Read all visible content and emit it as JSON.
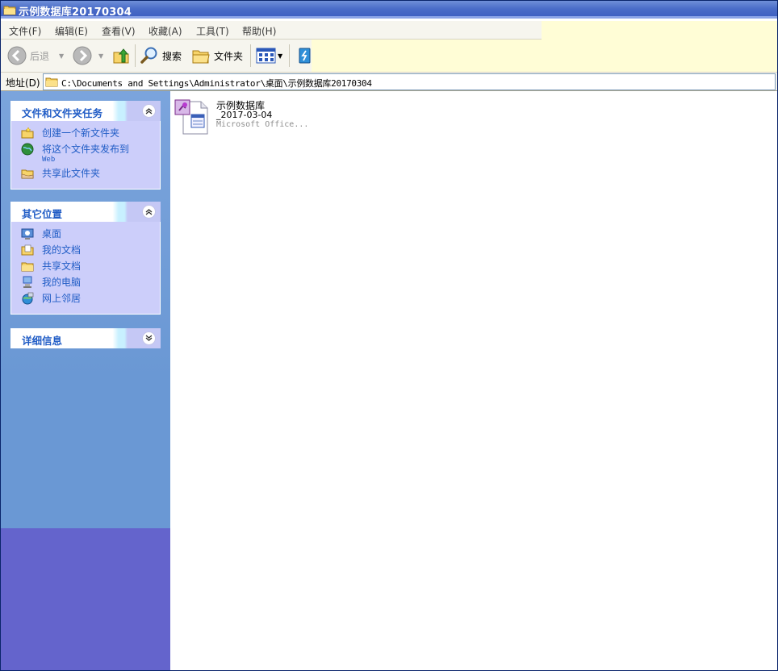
{
  "window": {
    "title": "示例数据库20170304"
  },
  "menu": {
    "items": [
      {
        "label": "文件(F)"
      },
      {
        "label": "编辑(E)"
      },
      {
        "label": "查看(V)"
      },
      {
        "label": "收藏(A)"
      },
      {
        "label": "工具(T)"
      },
      {
        "label": "帮助(H)"
      }
    ]
  },
  "toolbar": {
    "back_label": "后退",
    "search_label": "搜索",
    "folders_label": "文件夹"
  },
  "address": {
    "label": "地址(D)",
    "path": "C:\\Documents and Settings\\Administrator\\桌面\\示例数据库20170304"
  },
  "tasks_panel": {
    "title": "文件和文件夹任务",
    "items": [
      {
        "label": "创建一个新文件夹",
        "icon": "new-folder-icon"
      },
      {
        "label": "将这个文件夹发布到",
        "sub": "Web",
        "icon": "publish-web-icon"
      },
      {
        "label": "共享此文件夹",
        "icon": "share-folder-icon"
      }
    ]
  },
  "places_panel": {
    "title": "其它位置",
    "items": [
      {
        "label": "桌面",
        "icon": "desktop-icon"
      },
      {
        "label": "我的文档",
        "icon": "my-documents-icon"
      },
      {
        "label": "共享文档",
        "icon": "shared-documents-icon"
      },
      {
        "label": "我的电脑",
        "icon": "my-computer-icon"
      },
      {
        "label": "网上邻居",
        "icon": "network-icon"
      }
    ]
  },
  "details_panel": {
    "title": "详细信息"
  },
  "files": [
    {
      "name": "示例数据库",
      "date": "_2017-03-04",
      "type": "Microsoft Office..."
    }
  ],
  "colors": {
    "title_bar": "#4a6cc8",
    "left_pane": "#6a98d4",
    "panel_body": "#cccefa",
    "link": "#215dc6"
  }
}
